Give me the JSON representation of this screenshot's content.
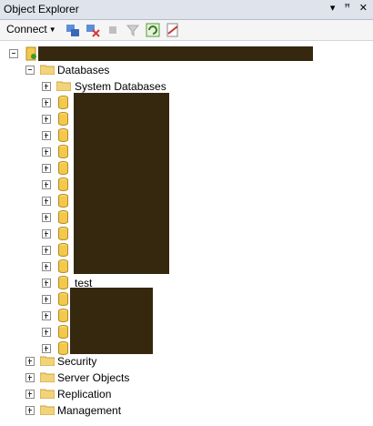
{
  "window": {
    "title": "Object Explorer",
    "pin_glyph": "▾ ꟸ ✕"
  },
  "toolbar": {
    "connect_label": "Connect",
    "icons": [
      "connect-object-explorer-icon",
      "disconnect-icon",
      "stop-icon",
      "filter-icon",
      "refresh-icon",
      "summary-report-icon"
    ]
  },
  "tree": {
    "server": {
      "label": "",
      "redacted": true
    },
    "databases": {
      "label": "Databases",
      "system": "System Databases",
      "test": "test"
    },
    "security": "Security",
    "server_objects": "Server Objects",
    "replication": "Replication",
    "management": "Management"
  },
  "colors": {
    "redaction": "#35280f",
    "folder": "#f3d37a",
    "db": "#f2c94c"
  }
}
